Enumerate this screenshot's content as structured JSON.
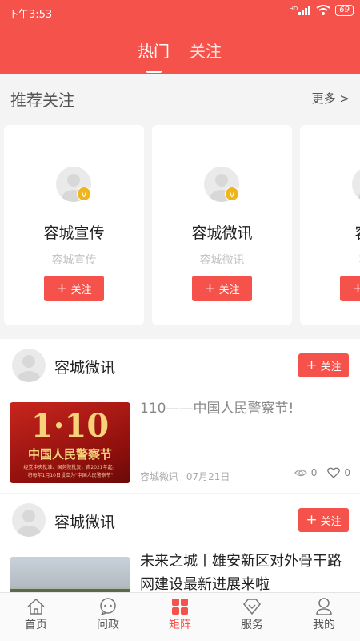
{
  "status": {
    "time": "下午3:53",
    "signal": "HD",
    "battery": "69"
  },
  "tabs": [
    {
      "label": "热门",
      "active": true
    },
    {
      "label": "关注",
      "active": false
    }
  ],
  "recommend": {
    "title": "推荐关注",
    "more": "更多 >",
    "cards": [
      {
        "name": "容城宣传",
        "subtitle": "容城宣传",
        "button": "关注"
      },
      {
        "name": "容城微讯",
        "subtitle": "容城微讯",
        "button": "关注"
      },
      {
        "name": "容城",
        "subtitle": "容城",
        "button": "关注"
      }
    ]
  },
  "posts": [
    {
      "author": "容城微讯",
      "button": "关注",
      "title": "110——中国人民警察节!",
      "source": "容城微讯",
      "date": "07月21日",
      "views": "0",
      "likes": "0",
      "thumb": {
        "big": "1·10",
        "caption": "中国人民警察节",
        "small1": "经党中央批准、国务院批复，自2021年起，",
        "small2": "将每年1月10日设立为\"中国人民警察节\""
      }
    },
    {
      "author": "容城微讯",
      "button": "关注",
      "title": "未来之城丨雄安新区对外骨干路网建设最新进展来啦"
    }
  ],
  "nav": [
    {
      "label": "首页",
      "icon": "home-icon",
      "active": false
    },
    {
      "label": "问政",
      "icon": "chat-icon",
      "active": false
    },
    {
      "label": "矩阵",
      "icon": "grid-icon",
      "active": true
    },
    {
      "label": "服务",
      "icon": "diamond-icon",
      "active": false
    },
    {
      "label": "我的",
      "icon": "user-icon",
      "active": false
    }
  ],
  "colors": {
    "brand": "#f4524a",
    "badge": "#f1b51c"
  }
}
